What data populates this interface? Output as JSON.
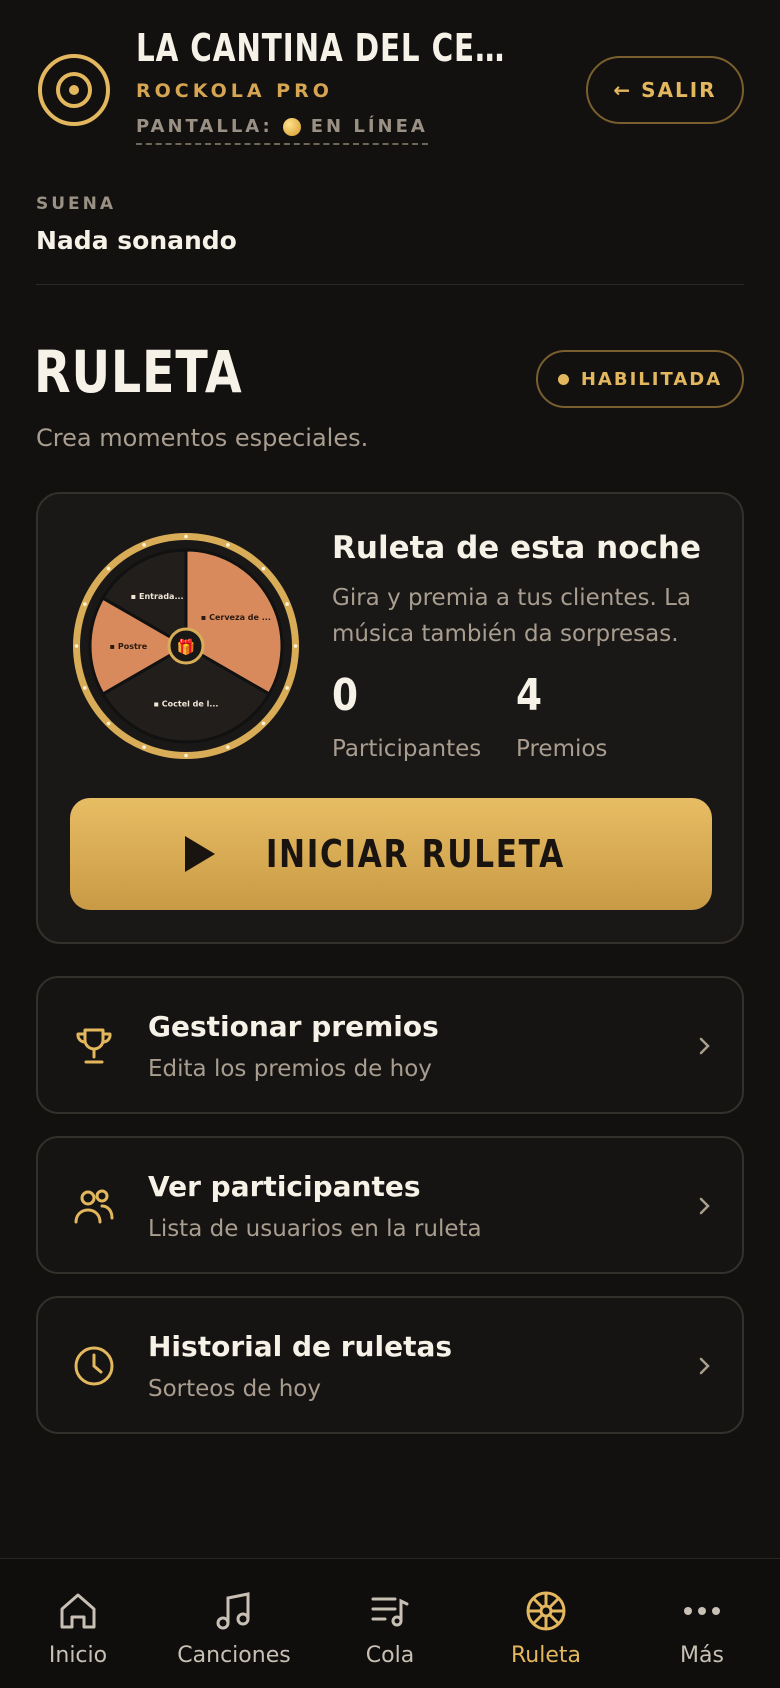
{
  "header": {
    "venue_title": "LA CANTINA DEL CENTRO ·...",
    "subtitle": "ROCKOLA PRO",
    "screen_label": "PANTALLA:",
    "screen_status": "EN LÍNEA",
    "exit_label": "← SALIR"
  },
  "now_playing": {
    "label": "SUENA",
    "value": "Nada sonando"
  },
  "section": {
    "title": "RULETA",
    "subtitle": "Crea momentos especiales.",
    "badge": "HABILITADA"
  },
  "roulette_card": {
    "title": "Ruleta de esta noche",
    "description": "Gira y premia a tus clientes. La música también da sorpresas.",
    "participants_value": "0",
    "participants_label": "Participantes",
    "prizes_value": "4",
    "prizes_label": "Premios",
    "start_label": "INICIAR RULETA",
    "wheel_segments": [
      {
        "label": "Cerveza de ...",
        "icon": "beer-icon",
        "color": "#d88a5c",
        "fraction": 0.3333
      },
      {
        "label": "Coctel de l...",
        "icon": "cocktail-icon",
        "color": "#211e1b",
        "fraction": 0.3333
      },
      {
        "label": "Postre",
        "icon": "dessert-icon",
        "color": "#d88a5c",
        "fraction": 0.1667
      },
      {
        "label": "Entrada...",
        "icon": "ticket-icon",
        "color": "#211e1b",
        "fraction": 0.1667
      }
    ],
    "wheel_rim_color": "#d9ad57"
  },
  "menu": [
    {
      "title": "Gestionar premios",
      "subtitle": "Edita los premios de hoy",
      "icon": "trophy-icon"
    },
    {
      "title": "Ver participantes",
      "subtitle": "Lista de usuarios en la ruleta",
      "icon": "users-icon"
    },
    {
      "title": "Historial de ruletas",
      "subtitle": "Sorteos de hoy",
      "icon": "clock-icon"
    }
  ],
  "nav": [
    {
      "label": "Inicio",
      "icon": "home-icon",
      "active": false
    },
    {
      "label": "Canciones",
      "icon": "music-note-icon",
      "active": false
    },
    {
      "label": "Cola",
      "icon": "queue-icon",
      "active": false
    },
    {
      "label": "Ruleta",
      "icon": "wheel-icon",
      "active": true
    },
    {
      "label": "Más",
      "icon": "more-icon",
      "active": false
    }
  ],
  "colors": {
    "accent": "#e3b75e",
    "background": "#121110",
    "card": "#1a1816"
  }
}
